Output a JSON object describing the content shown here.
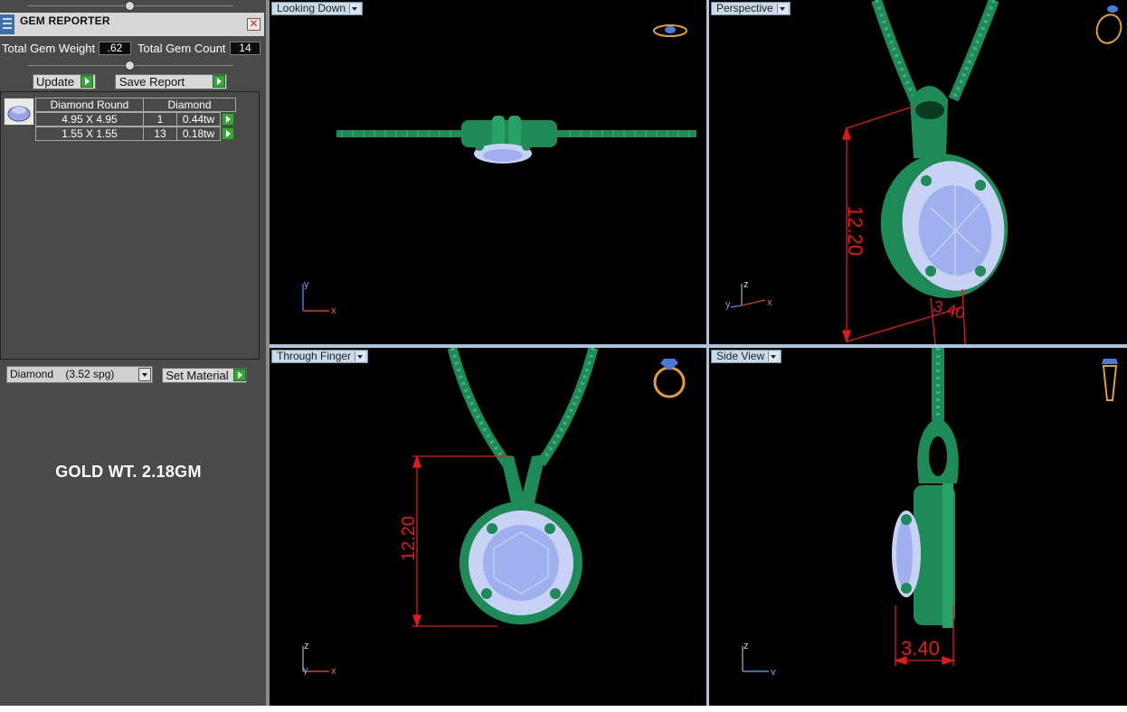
{
  "panel": {
    "title": "GEM REPORTER",
    "total_gem_weight_label": "Total Gem Weight",
    "total_gem_weight_value": ".62",
    "total_gem_count_label": "Total Gem Count",
    "total_gem_count_value": "14",
    "update_label": "Update",
    "save_report_label": "Save Report",
    "gem_table": {
      "headers": [
        "Diamond Round",
        "Diamond"
      ],
      "rows": [
        {
          "size": "4.95 X 4.95",
          "count": "1",
          "weight": "0.44tw"
        },
        {
          "size": "1.55 X 1.55",
          "count": "13",
          "weight": "0.18tw"
        }
      ]
    },
    "material_select": "Diamond    (3.52 spg)",
    "set_material_label": "Set Material",
    "gold_weight_note": "GOLD WT. 2.18GM"
  },
  "viewports": {
    "top_left": {
      "label": "Looking Down"
    },
    "top_right": {
      "label": "Perspective",
      "dim_height": "12.20",
      "dim_depth": "3.40"
    },
    "bottom_left": {
      "label": "Through Finger",
      "dim_height": "12.20"
    },
    "bottom_right": {
      "label": "Side View",
      "dim_depth": "3.40"
    }
  },
  "axes": {
    "x": "x",
    "y": "y",
    "z": "z"
  },
  "colors": {
    "metal": "#1f8f5c",
    "stone": "#c8d2f5",
    "dimension": "#e01a1a",
    "viewport_bg": "#000000",
    "panel_bg": "#4a4a4a",
    "grid_line": "#a8c6dc"
  }
}
